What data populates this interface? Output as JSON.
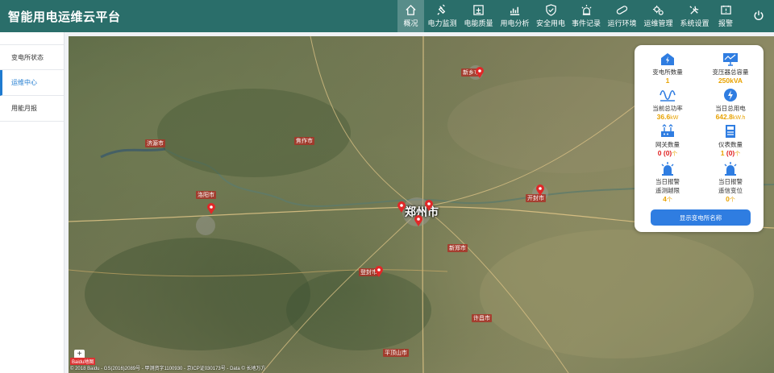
{
  "app": {
    "title": "智能用电运维云平台"
  },
  "nav": {
    "items": [
      {
        "label": "概况",
        "icon": "home-icon",
        "active": true
      },
      {
        "label": "电力监测",
        "icon": "plug-icon"
      },
      {
        "label": "电能质量",
        "icon": "quality-icon"
      },
      {
        "label": "用电分析",
        "icon": "bar-chart-icon"
      },
      {
        "label": "安全用电",
        "icon": "shield-icon"
      },
      {
        "label": "事件记录",
        "icon": "alarm-light-icon"
      },
      {
        "label": "运行环境",
        "icon": "pill-icon"
      },
      {
        "label": "运维管理",
        "icon": "gears-icon"
      },
      {
        "label": "系统设置",
        "icon": "tools-icon"
      },
      {
        "label": "报警",
        "icon": "alert-box-icon"
      }
    ],
    "power_icon": "power-icon"
  },
  "sidebar": {
    "items": [
      {
        "label": "变电所状态"
      },
      {
        "label": "运维中心",
        "active": true
      },
      {
        "label": "用能月报"
      }
    ]
  },
  "map": {
    "cities": [
      {
        "label": "郑州市",
        "big": true
      },
      {
        "label": "开封市"
      },
      {
        "label": "洛阳市"
      },
      {
        "label": "新乡市"
      },
      {
        "label": "焦作市"
      },
      {
        "label": "许昌市"
      },
      {
        "label": "平顶山市"
      },
      {
        "label": "济源市"
      },
      {
        "label": "登封市"
      },
      {
        "label": "新郑市"
      }
    ],
    "credit": "© 2018 Baidu - GS(2016)2089号 - 甲测资字1100930 - 京ICP证030173号 - Data © 长地万方",
    "baidu_logo": "Baidu地图",
    "zoom_label": "+"
  },
  "stats": {
    "substation_count": {
      "label": "变电所数量",
      "value": "1",
      "icon": "substation-icon"
    },
    "transformer_capacity": {
      "label": "变压器总容量",
      "value": "250kVA",
      "icon": "monitor-icon"
    },
    "total_power": {
      "label": "当前总功率",
      "value": "36.6",
      "unit": "kW",
      "icon": "waveform-icon"
    },
    "daily_energy": {
      "label": "当日总用电",
      "value": "642.8",
      "unit": "kW.h",
      "icon": "lightning-icon"
    },
    "gateway_count": {
      "label": "网关数量",
      "value": "0",
      "offline": "(0)",
      "unit": "个",
      "icon": "gateway-icon"
    },
    "meter_count": {
      "label": "仪表数量",
      "value": "1",
      "offline": "(0)",
      "unit": "个",
      "icon": "meter-icon"
    },
    "daily_telemetry_alarm": {
      "label_line1": "当日报警",
      "label_line2": "遥测越限",
      "value": "4",
      "unit": "个",
      "icon": "siren-icon"
    },
    "daily_telesignal_alarm": {
      "label_line1": "当日报警",
      "label_line2": "遥信变位",
      "value": "0",
      "unit": "个",
      "icon": "siren-icon"
    },
    "show_names_button": "显示变电所名称"
  }
}
